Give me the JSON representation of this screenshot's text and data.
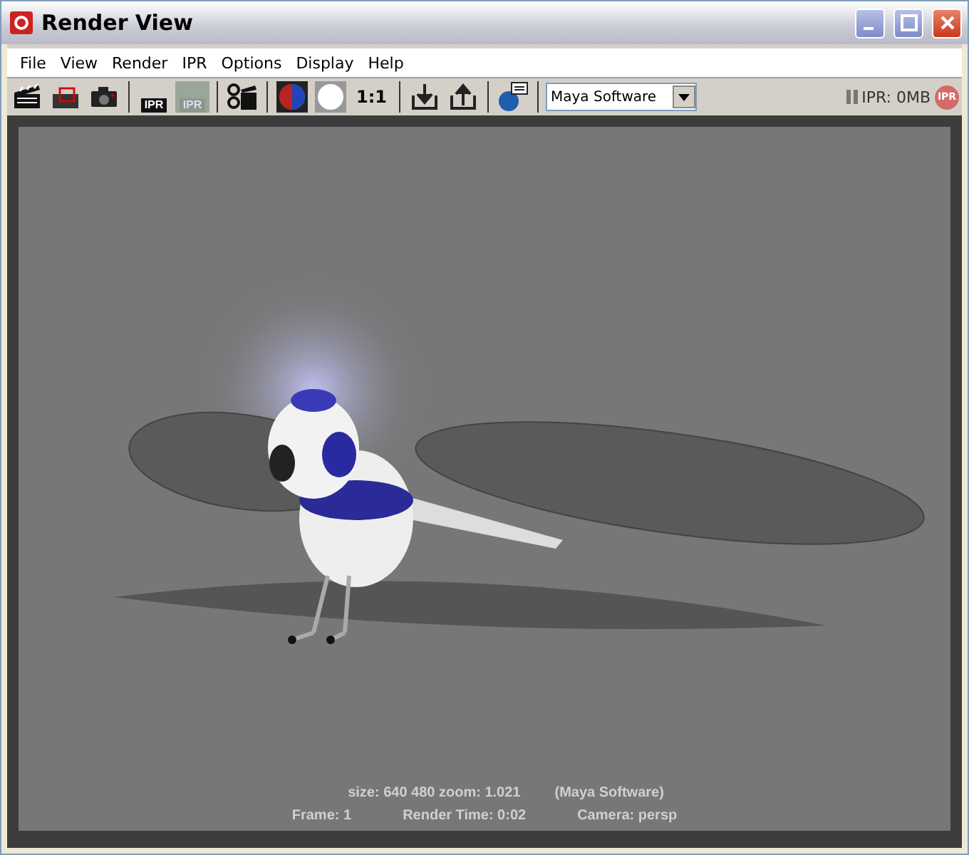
{
  "window": {
    "title": "Render View"
  },
  "menu": [
    {
      "label": "File"
    },
    {
      "label": "View"
    },
    {
      "label": "Render"
    },
    {
      "label": "IPR"
    },
    {
      "label": "Options"
    },
    {
      "label": "Display"
    },
    {
      "label": "Help"
    }
  ],
  "toolbar": {
    "ipr_render_label": "IPR",
    "ipr_refresh": {
      "label": "IPR",
      "disabled": true
    },
    "scale_button": "1:1",
    "renderer_select": {
      "value": "Maya Software"
    },
    "ipr_memory": "IPR: 0MB",
    "ipr_badge": "IPR"
  },
  "render_info": {
    "line_1": [
      "size:  640  480 zoom: 1.021",
      "(Maya Software)"
    ],
    "line_2": [
      "Frame: 1",
      "Render Time: 0:02",
      "Camera: persp"
    ]
  }
}
